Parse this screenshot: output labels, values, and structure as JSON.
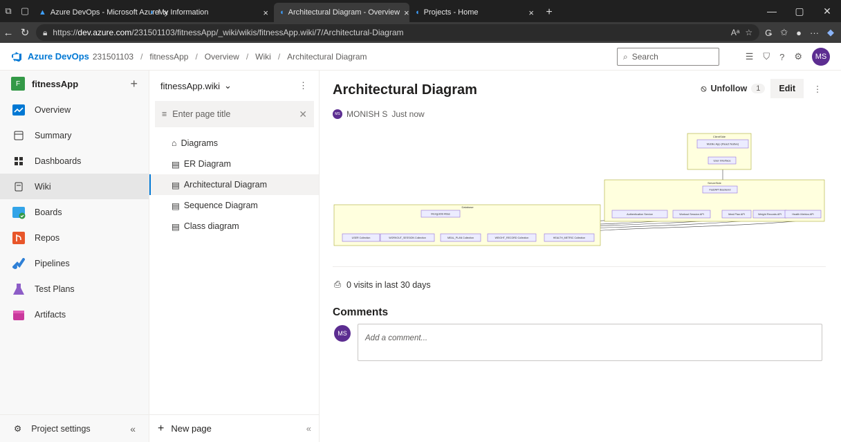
{
  "browser": {
    "tabs": [
      {
        "label": "Azure DevOps - Microsoft Azure",
        "active": false
      },
      {
        "label": "My Information",
        "active": false
      },
      {
        "label": "Architectural Diagram - Overview",
        "active": true
      },
      {
        "label": "Projects - Home",
        "active": false
      }
    ],
    "url_prefix": "https://",
    "url_domain": "dev.azure.com",
    "url_path": "/231501103/fitnessApp/_wiki/wikis/fitnessApp.wiki/7/Architectural-Diagram"
  },
  "header": {
    "brand": "Azure DevOps",
    "org": "231501103",
    "breadcrumb": [
      "fitnessApp",
      "Overview",
      "Wiki",
      "Architectural Diagram"
    ],
    "search_placeholder": "Search",
    "avatar_initials": "MS"
  },
  "leftnav": {
    "project_badge": "F",
    "project_name": "fitnessApp",
    "items": [
      {
        "label": "Overview"
      },
      {
        "label": "Summary"
      },
      {
        "label": "Dashboards"
      },
      {
        "label": "Wiki"
      },
      {
        "label": "Boards"
      },
      {
        "label": "Repos"
      },
      {
        "label": "Pipelines"
      },
      {
        "label": "Test Plans"
      },
      {
        "label": "Artifacts"
      }
    ],
    "settings_label": "Project settings"
  },
  "wikitree": {
    "wiki_name": "fitnessApp.wiki",
    "filter_placeholder": "Enter page title",
    "pages": [
      {
        "label": "Diagrams"
      },
      {
        "label": "ER Diagram"
      },
      {
        "label": "Architectural Diagram"
      },
      {
        "label": "Sequence Diagram"
      },
      {
        "label": "Class diagram"
      }
    ],
    "new_page_label": "New page"
  },
  "main": {
    "title": "Architectural Diagram",
    "unfollow_label": "Unfollow",
    "follower_count": "1",
    "edit_label": "Edit",
    "author": "MONISH S",
    "author_initials": "MS",
    "timestamp": "Just now",
    "visits": "0 visits in last 30 days",
    "comments_heading": "Comments",
    "comment_placeholder": "Add a comment...",
    "diagram": {
      "client_group": "ClientSide",
      "client_nodes": [
        "Mobile App (React Native)",
        "User Interface"
      ],
      "server_group": "ServerSide",
      "backend": "FastAPI Backend",
      "services": [
        "Authentication Service",
        "Workout Session API",
        "Meal Plan API",
        "Weight Records API",
        "Health Metrics API"
      ],
      "db_group": "Database",
      "db": "MongoDB Atlas",
      "collections": [
        "USER Collection",
        "WORKOUT_SESSION Collection",
        "MEAL_PLAN Collection",
        "WEIGHT_RECORD Collection",
        "HEALTH_METRIC Collection"
      ]
    }
  },
  "colors": {
    "accent": "#0078d4",
    "avatar": "#5c2d91",
    "project_badge": "#339947",
    "diagram_group_fill": "#ffffde",
    "diagram_node_fill": "#ececff"
  }
}
